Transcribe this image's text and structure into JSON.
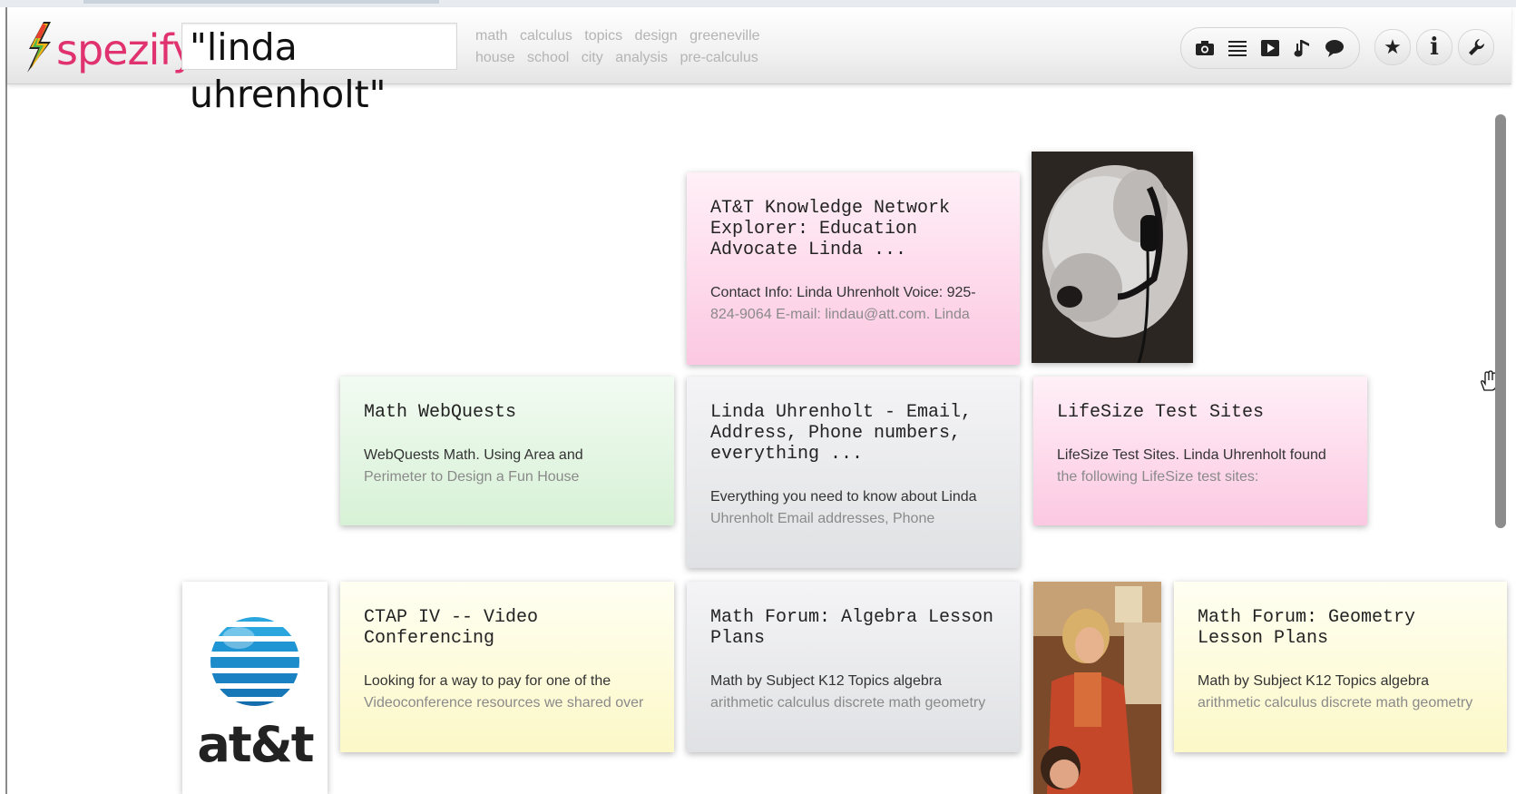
{
  "app": {
    "name": "spezify"
  },
  "search": {
    "query": "\"linda uhrenholt\""
  },
  "tags": {
    "row1": [
      "math",
      "calculus",
      "topics",
      "design",
      "greeneville"
    ],
    "row2": [
      "house",
      "school",
      "city",
      "analysis",
      "pre-calculus"
    ]
  },
  "media_filters": [
    "camera-icon",
    "list-icon",
    "video-play-icon",
    "music-note-icon",
    "speech-bubble-icon"
  ],
  "toolbar_buttons": [
    "star-icon",
    "info-icon",
    "wrench-icon"
  ],
  "colors": {
    "logo_text": "#e0326e",
    "card_pink": "#fcc8e2",
    "card_green": "#d7f1d6",
    "card_grey": "#e0e1e4",
    "card_yellow": "#fcf8c8"
  },
  "cards": {
    "att_knowledge": {
      "title": "AT&T Knowledge Network\nExplorer: Education\nAdvocate Linda ...",
      "line1": "Contact Info: Linda Uhrenholt Voice: 925-",
      "line2": "824-9064 E-mail: lindau@att.com. Linda"
    },
    "webquests": {
      "title": "Math WebQuests",
      "line1": "WebQuests Math. Using Area and",
      "line2": "Perimeter to Design a Fun House"
    },
    "linda_email": {
      "title": "Linda Uhrenholt - Email,\nAddress, Phone numbers,\neverything ...",
      "line1": "Everything you need to know about Linda",
      "line2": "Uhrenholt Email addresses, Phone"
    },
    "lifesize": {
      "title": "LifeSize Test Sites",
      "line1": "LifeSize Test Sites. Linda Uhrenholt found",
      "line2": "the following LifeSize test sites:"
    },
    "ctap": {
      "title": "CTAP IV -- Video\nConferencing",
      "line1": "Looking for a way to pay for one of the",
      "line2": "Videoconference resources we shared over"
    },
    "algebra": {
      "title": "Math Forum: Algebra Lesson\nPlans",
      "line1": "Math by Subject K12 Topics algebra",
      "line2": "arithmetic calculus discrete math geometry"
    },
    "geometry": {
      "title": "Math Forum: Geometry\nLesson Plans",
      "line1": "Math by Subject K12 Topics algebra",
      "line2": "arithmetic calculus discrete math geometry"
    }
  },
  "att_logo": {
    "text": "at&t"
  }
}
